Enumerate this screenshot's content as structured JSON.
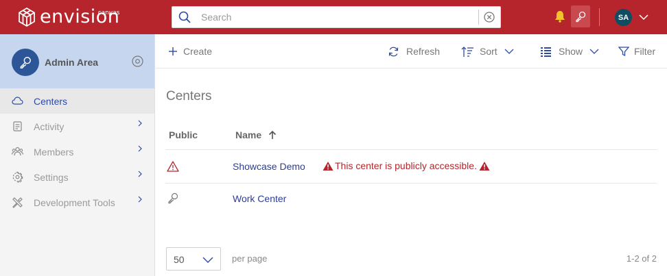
{
  "header": {
    "logo_text": "envision",
    "logo_sub": "canvas",
    "search_placeholder": "Search",
    "avatar_initials": "SA"
  },
  "sidebar": {
    "title": "Admin Area",
    "items": [
      {
        "label": "Centers",
        "icon": "cloud-icon",
        "active": true
      },
      {
        "label": "Activity",
        "icon": "activity-icon",
        "has_children": true
      },
      {
        "label": "Members",
        "icon": "members-icon",
        "has_children": true
      },
      {
        "label": "Settings",
        "icon": "gear-icon",
        "has_children": true
      },
      {
        "label": "Development Tools",
        "icon": "tools-icon",
        "has_children": true
      }
    ]
  },
  "toolbar": {
    "create": "Create",
    "refresh": "Refresh",
    "sort": "Sort",
    "show": "Show",
    "filter": "Filter"
  },
  "main": {
    "title": "Centers",
    "columns": [
      "Public",
      "Name"
    ],
    "sort_column": "Name",
    "sort_direction": "ascending",
    "rows": [
      {
        "public_icon": "warning-icon",
        "name": "Showcase Demo",
        "warning": "This center is publicly accessible."
      },
      {
        "public_icon": "key-icon",
        "name": "Work Center",
        "warning": ""
      }
    ]
  },
  "pager": {
    "page_size": "50",
    "per_page_label": "per page",
    "count": "1-2 of 2"
  },
  "colors": {
    "brand": "#b5252b",
    "sidebar_header": "#c5d6ee",
    "avatar": "#0f4d63",
    "link": "#2b3d96"
  }
}
